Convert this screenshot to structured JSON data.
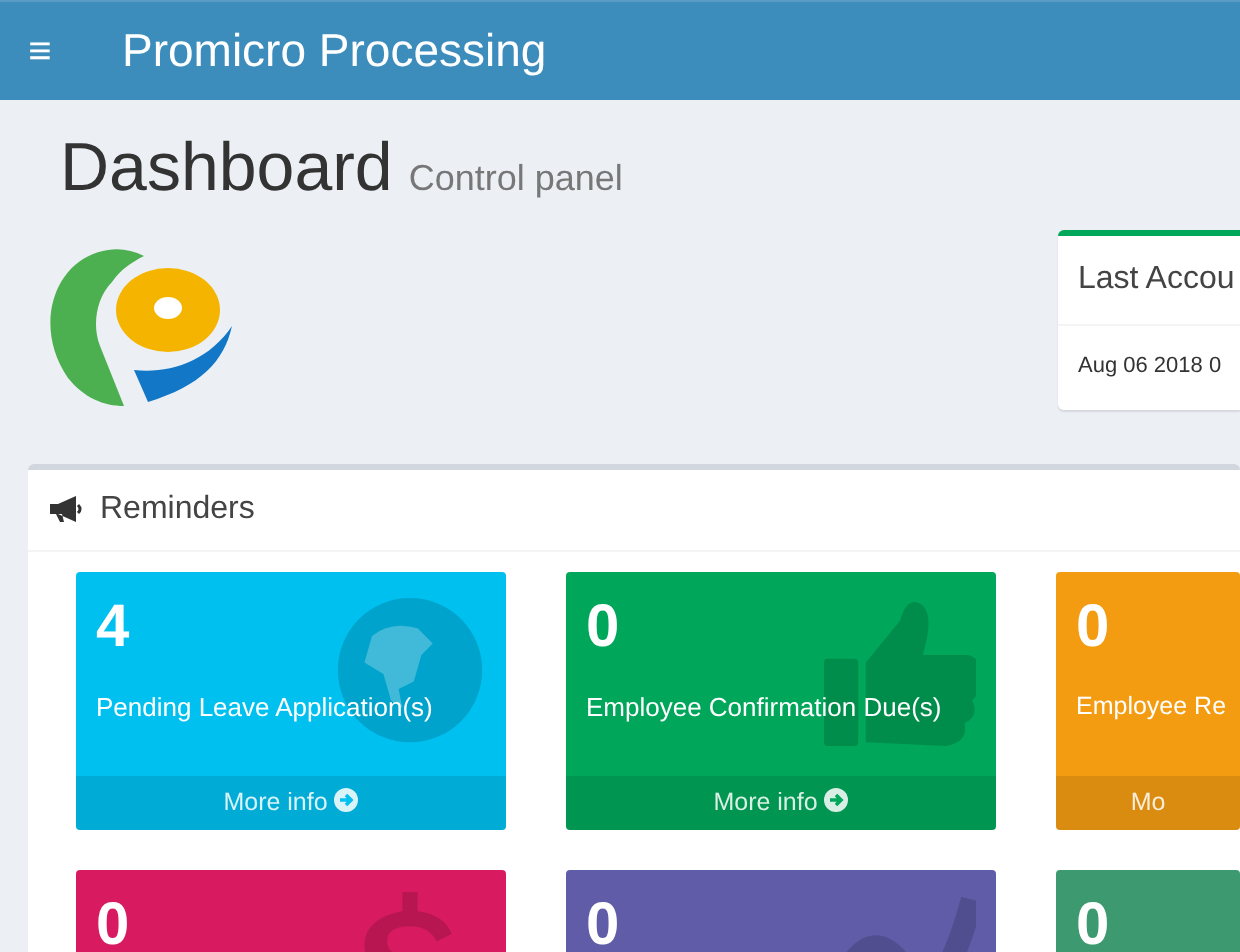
{
  "header": {
    "menu_glyph": "≡",
    "title": "Promicro Processing"
  },
  "page": {
    "title": "Dashboard",
    "subtitle": "Control panel"
  },
  "account_card": {
    "title": "Last Accou",
    "value": "Aug 06 2018 0"
  },
  "reminders": {
    "title": "Reminders",
    "boxes": [
      {
        "number": "4",
        "label": "Pending Leave Application(s)",
        "footer": "More info",
        "color": "#00c0ef"
      },
      {
        "number": "0",
        "label": "Employee Confirmation Due(s)",
        "footer": "More info",
        "color": "#00a65a"
      },
      {
        "number": "0",
        "label": "Employee Re",
        "footer": "Mo",
        "color": "#f39c12"
      },
      {
        "number": "0",
        "color": "#d81b60"
      },
      {
        "number": "0",
        "color": "#605ca8"
      },
      {
        "number": "0",
        "color": "#3d9970"
      }
    ]
  }
}
